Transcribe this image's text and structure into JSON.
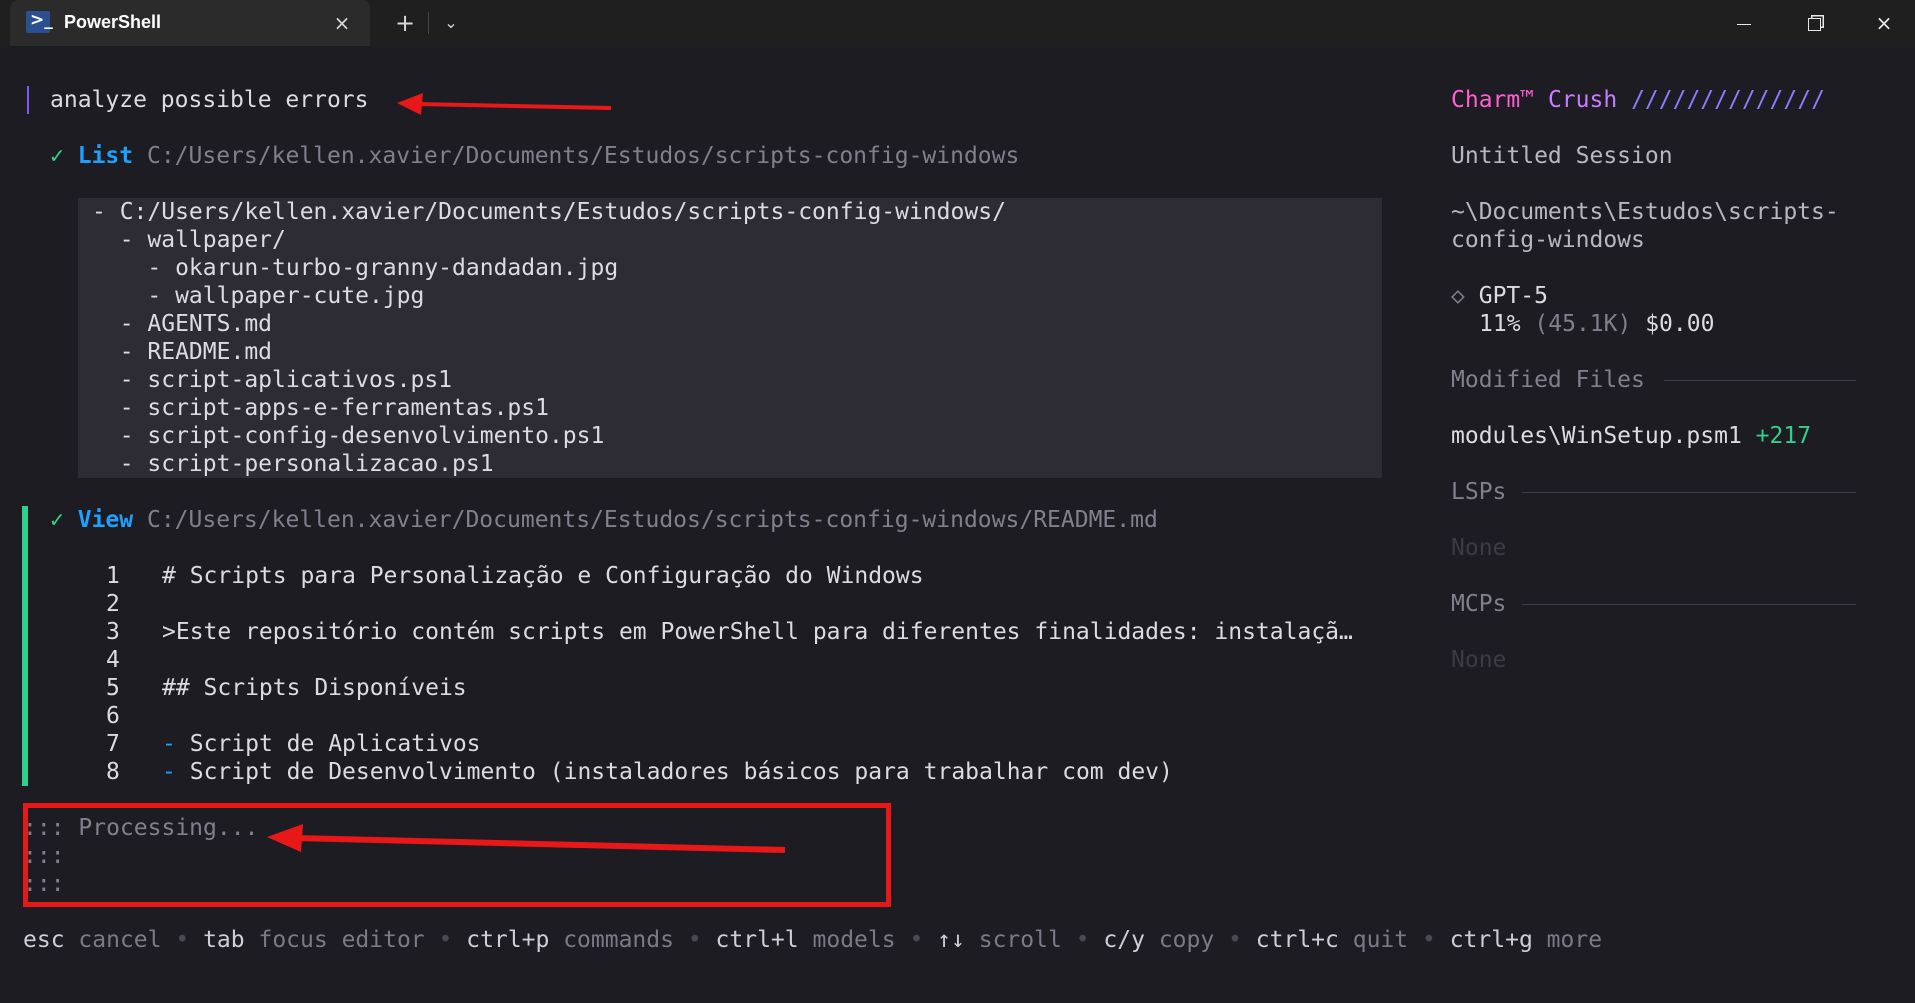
{
  "window": {
    "tab_title": "PowerShell",
    "tab_icon": "powershell-icon",
    "close_tab_icon": "×",
    "new_tab_icon": "+",
    "dropdown_icon": "⌄",
    "minimize_icon": "minimize-icon",
    "maximize_icon": "maximize-icon",
    "close_window_icon": "×"
  },
  "prompt": {
    "text": "analyze possible errors"
  },
  "list_tool": {
    "check": "✓",
    "label": "List",
    "path": "C:/Users/kellen.xavier/Documents/Estudos/scripts-config-windows",
    "entries": [
      "- C:/Users/kellen.xavier/Documents/Estudos/scripts-config-windows/",
      "  - wallpaper/",
      "    - okarun-turbo-granny-dandadan.jpg",
      "    - wallpaper-cute.jpg",
      "  - AGENTS.md",
      "  - README.md",
      "  - script-aplicativos.ps1",
      "  - script-apps-e-ferramentas.ps1",
      "  - script-config-desenvolvimento.ps1",
      "  - script-personalizacao.ps1"
    ]
  },
  "view_tool": {
    "check": "✓",
    "label": "View",
    "path": "C:/Users/kellen.xavier/Documents/Estudos/scripts-config-windows/README.md",
    "lines": [
      {
        "num": "1",
        "bullet": "",
        "text": "# Scripts para Personalização e Configuração do Windows"
      },
      {
        "num": "2",
        "bullet": "",
        "text": ""
      },
      {
        "num": "3",
        "bullet": "",
        "text": ">Este repositório contém scripts em PowerShell para diferentes finalidades: instalaçã…"
      },
      {
        "num": "4",
        "bullet": "",
        "text": ""
      },
      {
        "num": "5",
        "bullet": "",
        "text": "## Scripts Disponíveis"
      },
      {
        "num": "6",
        "bullet": "",
        "text": ""
      },
      {
        "num": "7",
        "bullet": "-",
        "text": "Script de Aplicativos"
      },
      {
        "num": "8",
        "bullet": "-",
        "text": "Script de Desenvolvimento (instaladores básicos para trabalhar com dev)"
      }
    ]
  },
  "processing": {
    "spinner": ":::",
    "text": "Processing...",
    "extra_spinner_1": ":::",
    "extra_spinner_2": ":::"
  },
  "sidebar": {
    "brand_charm": "Charm™",
    "brand_crush": "Crush",
    "brand_slashes": "//////////////",
    "session_title": "Untitled Session",
    "cwd_line1": "~\\Documents\\Estudos\\scripts-",
    "cwd_line2": "config-windows",
    "model_icon": "◇",
    "model_name": "GPT-5",
    "model_usage_pct": "11%",
    "model_tokens": "(45.1K)",
    "model_cost": "$0.00",
    "modified_files_label": "Modified Files",
    "modified_file_name": "modules\\WinSetup.psm1",
    "modified_file_delta": "+217",
    "lsps_label": "LSPs",
    "lsps_value": "None",
    "mcps_label": "MCPs",
    "mcps_value": "None"
  },
  "status_bar": {
    "items": [
      {
        "key": "esc",
        "desc": "cancel"
      },
      {
        "key": "tab",
        "desc": "focus editor"
      },
      {
        "key": "ctrl+p",
        "desc": "commands"
      },
      {
        "key": "ctrl+l",
        "desc": "models"
      },
      {
        "key": "↑↓",
        "desc": "scroll"
      },
      {
        "key": "c/y",
        "desc": "copy"
      },
      {
        "key": "ctrl+c",
        "desc": "quit"
      },
      {
        "key": "ctrl+g",
        "desc": "more"
      }
    ],
    "separator": "•"
  },
  "colors": {
    "background": "#1d1c22",
    "accent_purple": "#7c5cf0",
    "green": "#2fd18c",
    "blue": "#1ea0ff",
    "charm_pink": "#ff5fd2",
    "crush_purple": "#c77dff",
    "slash_blue": "#8a7cff",
    "annotation_red": "#e81818"
  }
}
